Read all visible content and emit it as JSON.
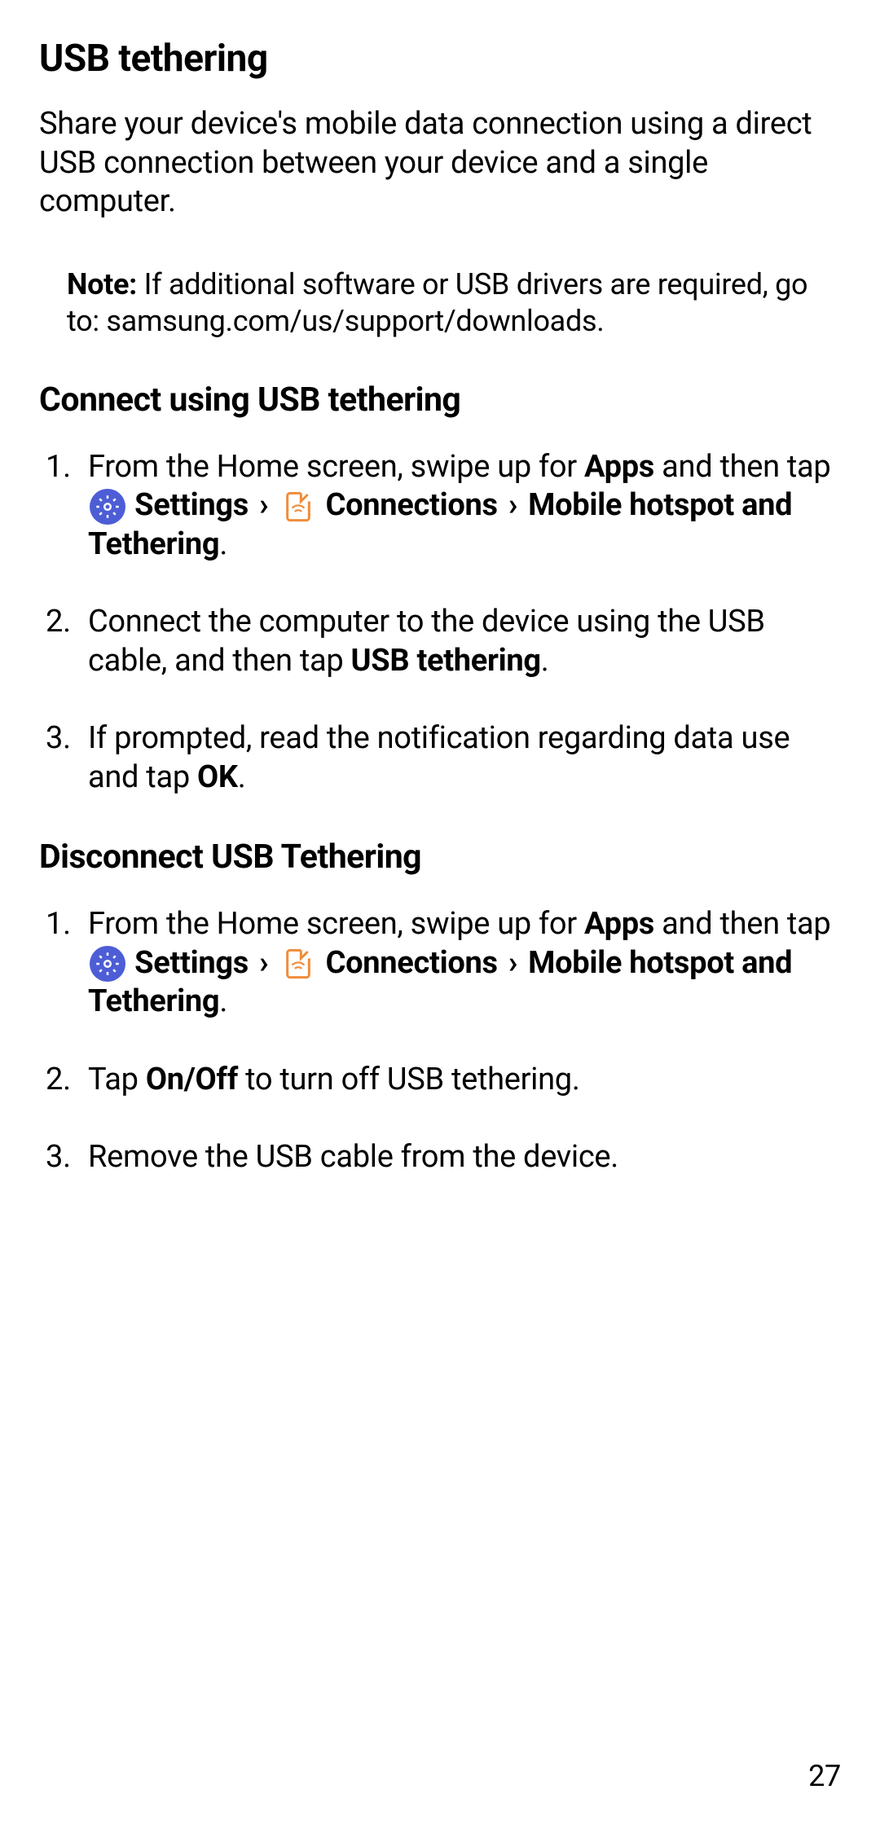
{
  "heading1": "USB tethering",
  "intro": "Share your device's mobile data connection using a direct USB connection between your device and a single computer.",
  "note_label": "Note: ",
  "note_body_1": "If additional software or USB drivers are required, go to: ",
  "note_body_2": "samsung.com/us/support/downloads",
  "note_body_3": ".",
  "heading2a": "Connect using USB tethering",
  "connect_steps": {
    "s1_a": "From the Home screen, swipe up for ",
    "s1_apps": "Apps",
    "s1_b": " and then tap ",
    "s1_settings": "Settings",
    "s1_chev1": "›",
    "s1_connections": "Connections",
    "s1_chev2": "›",
    "s1_mhot": "Mobile hotspot and Tethering",
    "s1_c": ".",
    "s2_a": "Connect the computer to the device using the USB cable, and then tap ",
    "s2_usb": "USB tethering",
    "s2_b": ".",
    "s3_a": "If prompted, read the notification regarding data use and tap ",
    "s3_ok": "OK",
    "s3_b": "."
  },
  "heading2b": "Disconnect USB Tethering",
  "disconnect_steps": {
    "s1_a": "From the Home screen, swipe up for ",
    "s1_apps": "Apps",
    "s1_b": " and then tap ",
    "s1_settings": "Settings",
    "s1_chev1": "›",
    "s1_connections": "Connections",
    "s1_chev2": "›",
    "s1_mhot": "Mobile hotspot and Tethering",
    "s1_c": ".",
    "s2_a": "Tap ",
    "s2_onoff": "On/Off",
    "s2_b": " to turn off USB tethering.",
    "s3": "Remove the USB cable from the device."
  },
  "page_number": "27"
}
